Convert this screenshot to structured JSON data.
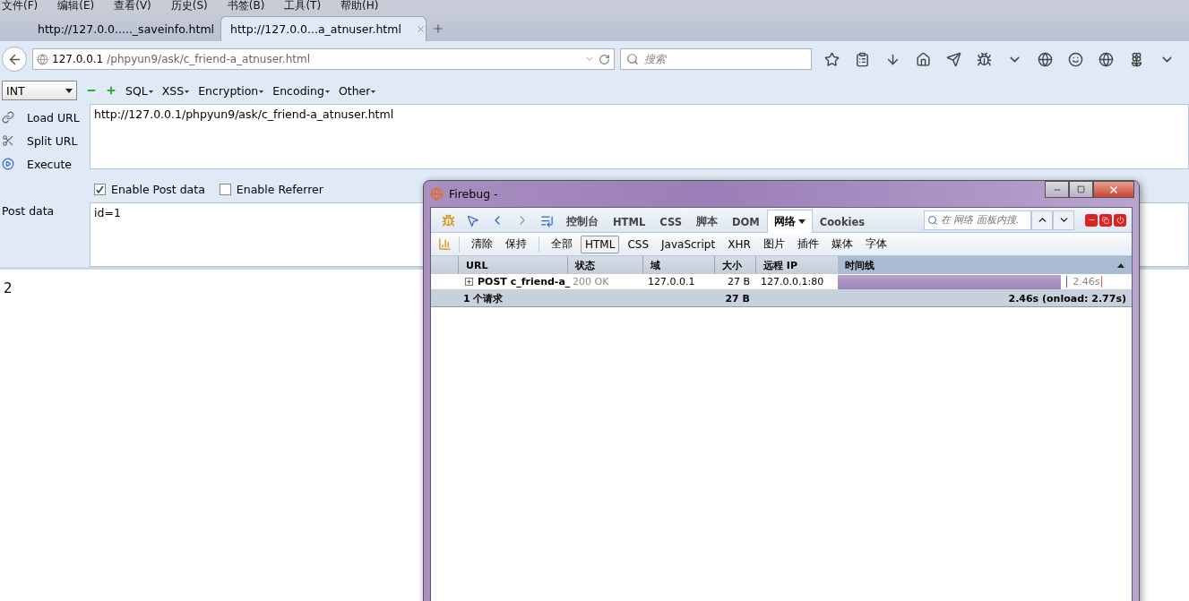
{
  "menu": [
    "文件(F)",
    "编辑(E)",
    "查看(V)",
    "历史(S)",
    "书签(B)",
    "工具(T)",
    "帮助(H)"
  ],
  "tabs": [
    {
      "label": "http://127.0.0....._saveinfo.html",
      "selected": false
    },
    {
      "label": "http://127.0.0...a_atnuser.html",
      "selected": true
    }
  ],
  "nav": {
    "host": "127.0.0.1",
    "path": "/phpyun9/ask/c_friend-a_atnuser.html",
    "search_placeholder": "搜索"
  },
  "hackbar": {
    "type_select": "INT",
    "menus": [
      "SQL",
      "XSS",
      "Encryption",
      "Encoding",
      "Other"
    ],
    "actions": [
      {
        "label": "Load URL",
        "kind": "load"
      },
      {
        "label": "Split URL",
        "kind": "split"
      },
      {
        "label": "Execute",
        "kind": "execute"
      }
    ],
    "url_value": "http://127.0.0.1/phpyun9/ask/c_friend-a_atnuser.html",
    "options": [
      {
        "label": "Enable Post data",
        "checked": true
      },
      {
        "label": "Enable Referrer",
        "checked": false
      }
    ],
    "post_label": "Post data",
    "post_value": "id=1"
  },
  "page": {
    "output": "2"
  },
  "firebug": {
    "title": "Firebug -",
    "panel_tabs": [
      {
        "label": "控制台",
        "selected": false
      },
      {
        "label": "HTML",
        "selected": false
      },
      {
        "label": "CSS",
        "selected": false
      },
      {
        "label": "脚本",
        "selected": false
      },
      {
        "label": "DOM",
        "selected": false
      },
      {
        "label": "网络",
        "selected": true
      },
      {
        "label": "Cookies",
        "selected": false
      }
    ],
    "search_placeholder": "在 网络 面板内搜.",
    "actions": [
      "清除",
      "保持"
    ],
    "filters": [
      {
        "label": "全部",
        "selected": false
      },
      {
        "label": "HTML",
        "selected": true
      },
      {
        "label": "CSS",
        "selected": false
      },
      {
        "label": "JavaScript",
        "selected": false
      },
      {
        "label": "XHR",
        "selected": false
      },
      {
        "label": "图片",
        "selected": false
      },
      {
        "label": "插件",
        "selected": false
      },
      {
        "label": "媒体",
        "selected": false
      },
      {
        "label": "字体",
        "selected": false
      }
    ],
    "columns": [
      "URL",
      "状态",
      "域",
      "大小",
      "远程 IP",
      "时间线"
    ],
    "rows": [
      {
        "url": "POST c_friend-a_",
        "status": "200 OK",
        "domain": "127.0.0.1",
        "size": "27 B",
        "remote_ip": "127.0.0.1:80",
        "timing": "2.46s",
        "level": 0.76
      }
    ],
    "summary": {
      "count": "1 个请求",
      "size": "27 B",
      "total": "2.46s (onload: 2.77s)"
    }
  }
}
